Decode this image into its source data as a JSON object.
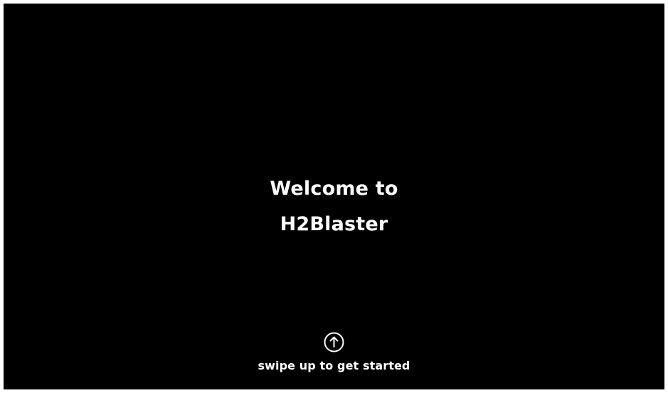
{
  "screen": {
    "background": "#000000",
    "text_color": "#ffffff"
  },
  "welcome": {
    "line1": "Welcome to",
    "line2": "H2Blaster"
  },
  "cta": {
    "icon": "arrow-up-circle-icon",
    "label": "swipe up to get started"
  }
}
